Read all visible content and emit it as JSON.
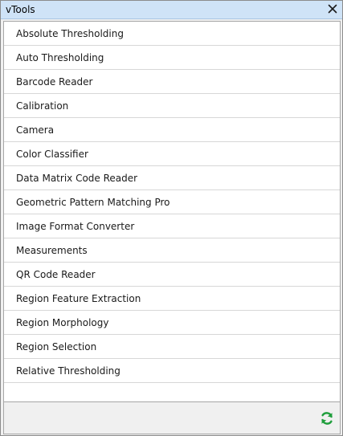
{
  "window": {
    "title": "vTools",
    "close_icon": "close-icon"
  },
  "tools": [
    "Absolute Thresholding",
    "Auto Thresholding",
    "Barcode Reader",
    "Calibration",
    "Camera",
    "Color Classifier",
    "Data Matrix Code Reader",
    "Geometric Pattern Matching Pro",
    "Image Format Converter",
    "Measurements",
    "QR Code Reader",
    "Region Feature Extraction",
    "Region Morphology",
    "Region Selection",
    "Relative Thresholding"
  ],
  "footer": {
    "refresh_icon": "refresh-icon",
    "refresh_color": "#1e9e3b"
  },
  "colors": {
    "titlebar": "#cfe3f7"
  }
}
